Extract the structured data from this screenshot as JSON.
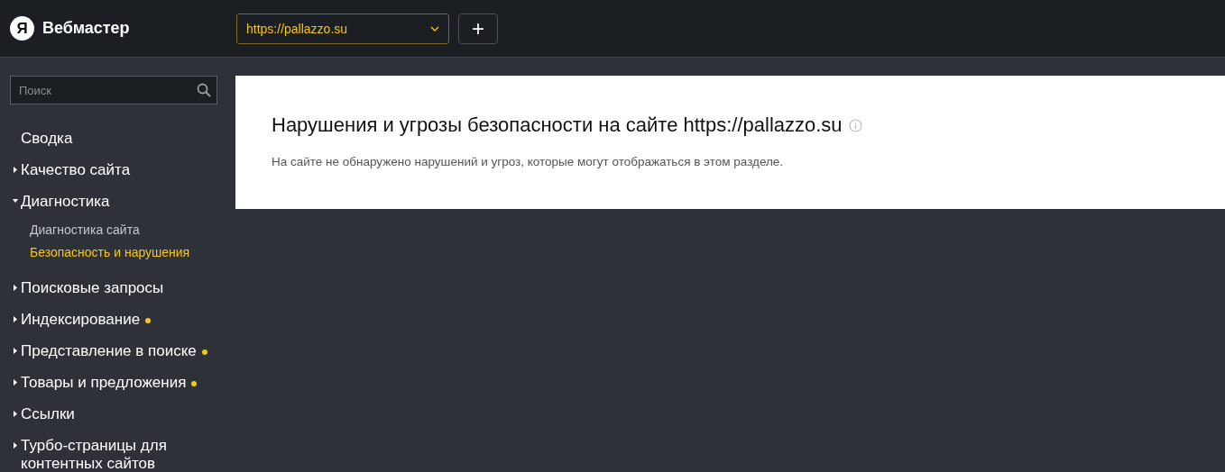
{
  "header": {
    "logo": "Я",
    "title": "Вебмастер",
    "site_select": {
      "value": "https://pallazzo.su"
    },
    "add_button": "+"
  },
  "sidebar": {
    "search": {
      "placeholder": "Поиск"
    },
    "items": [
      {
        "kind": "link",
        "label": "Сводка"
      },
      {
        "kind": "group",
        "label": "Качество сайта",
        "expanded": false,
        "badge": false
      },
      {
        "kind": "group",
        "label": "Диагностика",
        "expanded": true,
        "badge": false,
        "children": [
          {
            "label": "Диагностика сайта",
            "selected": false
          },
          {
            "label": "Безопасность и нарушения",
            "selected": true
          }
        ]
      },
      {
        "kind": "group",
        "label": "Поисковые запросы",
        "expanded": false,
        "badge": false
      },
      {
        "kind": "group",
        "label": "Индексирование",
        "expanded": false,
        "badge": true
      },
      {
        "kind": "group",
        "label": "Представление в поиске",
        "expanded": false,
        "badge": true
      },
      {
        "kind": "group",
        "label": "Товары и предложения",
        "expanded": false,
        "badge": true
      },
      {
        "kind": "group",
        "label": "Ссылки",
        "expanded": false,
        "badge": false
      },
      {
        "kind": "group",
        "label": "Турбо-страницы для контентных сайтов",
        "expanded": false,
        "badge": false
      }
    ]
  },
  "content": {
    "title": "Нарушения и угрозы безопасности на сайте https://pallazzo.su",
    "message": "На сайте не обнаружено нарушений и угроз, которые могут отображаться в этом разделе."
  }
}
